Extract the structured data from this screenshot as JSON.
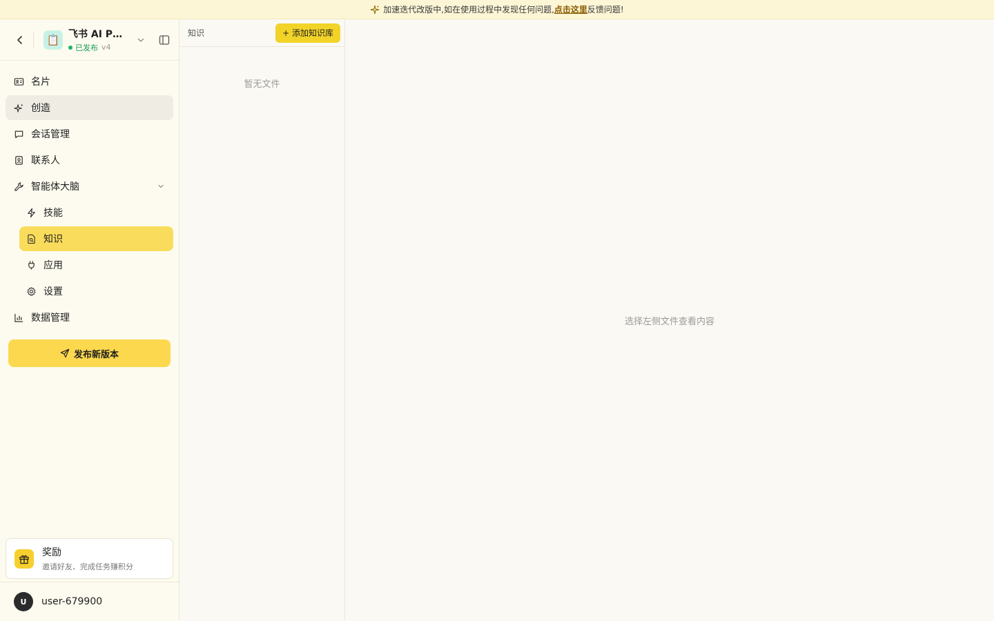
{
  "banner": {
    "text_before": "加速迭代改版中,如在使用过程中发现任何问题,",
    "link": "点击这里",
    "text_after": "反馈问题!"
  },
  "agent": {
    "avatar": "📋",
    "name": "飞书 AI PM...",
    "status": "已发布",
    "version": "v4"
  },
  "nav": {
    "card": "名片",
    "create": "创造",
    "conversations": "会话管理",
    "contacts": "联系人",
    "brain": "智能体大脑",
    "skills": "技能",
    "knowledge": "知识",
    "apps": "应用",
    "settings": "设置",
    "data": "数据管理"
  },
  "publish_label": "发布新版本",
  "reward": {
    "title": "奖励",
    "subtitle": "邀请好友、完成任务赚积分"
  },
  "user": {
    "initial": "U",
    "name": "user-679900"
  },
  "knowledge_panel": {
    "title": "知识",
    "add_label": "+ 添加知识库",
    "empty_text": "暂无文件"
  },
  "main": {
    "hint": "选择左侧文件查看内容"
  },
  "colors": {
    "accent_yellow": "#fadc5c",
    "published_green": "#22b26b"
  }
}
